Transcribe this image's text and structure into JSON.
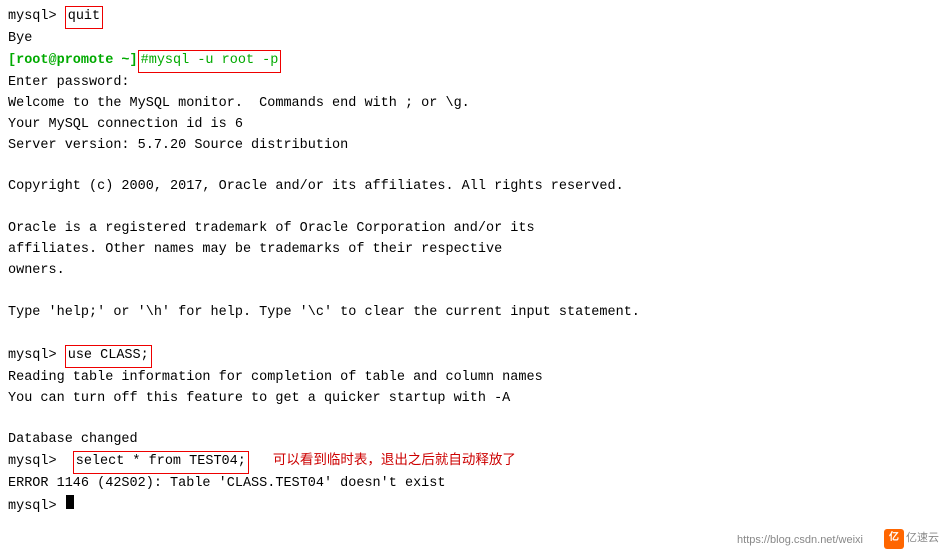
{
  "terminal": {
    "lines": [
      {
        "type": "mysql-cmd",
        "prompt": "mysql>",
        "cmd": "quit"
      },
      {
        "type": "plain",
        "text": "Bye"
      },
      {
        "type": "root-cmd",
        "prompt": "[root@promote ~]",
        "cmd": "#mysql -u root -p"
      },
      {
        "type": "plain",
        "text": "Enter password:"
      },
      {
        "type": "plain",
        "text": "Welcome to the MySQL monitor.  Commands end with ; or \\g."
      },
      {
        "type": "plain",
        "text": "Your MySQL connection id is 6"
      },
      {
        "type": "plain",
        "text": "Server version: 5.7.20 Source distribution"
      },
      {
        "type": "blank"
      },
      {
        "type": "plain",
        "text": "Copyright (c) 2000, 2017, Oracle and/or its affiliates. All rights reserved."
      },
      {
        "type": "blank"
      },
      {
        "type": "plain",
        "text": "Oracle is a registered trademark of Oracle Corporation and/or its"
      },
      {
        "type": "plain",
        "text": "affiliates. Other names may be trademarks of their respective"
      },
      {
        "type": "plain",
        "text": "owners."
      },
      {
        "type": "blank"
      },
      {
        "type": "plain",
        "text": "Type 'help;' or '\\h' for help. Type '\\c' to clear the current input statement."
      },
      {
        "type": "blank"
      },
      {
        "type": "mysql-cmd",
        "prompt": "mysql>",
        "cmd": "use CLASS;"
      },
      {
        "type": "plain",
        "text": "Reading table information for completion of table and column names"
      },
      {
        "type": "plain",
        "text": "You can turn off this feature to get a quicker startup with -A"
      },
      {
        "type": "blank"
      },
      {
        "type": "plain",
        "text": "Database changed"
      },
      {
        "type": "mysql-cmd-comment",
        "prompt": "mysql>",
        "cmd": "select * from TEST04;",
        "comment": "可以看到临时表，退出之后就自动释放了"
      },
      {
        "type": "plain",
        "text": "ERROR 1146 (42S02): Table 'CLASS.TEST04' doesn't exist"
      },
      {
        "type": "mysql-cursor",
        "prompt": "mysql>"
      }
    ],
    "watermark_csdn": "https://blog.csdn.net/weixi",
    "watermark_yiyun": "亿速云"
  }
}
